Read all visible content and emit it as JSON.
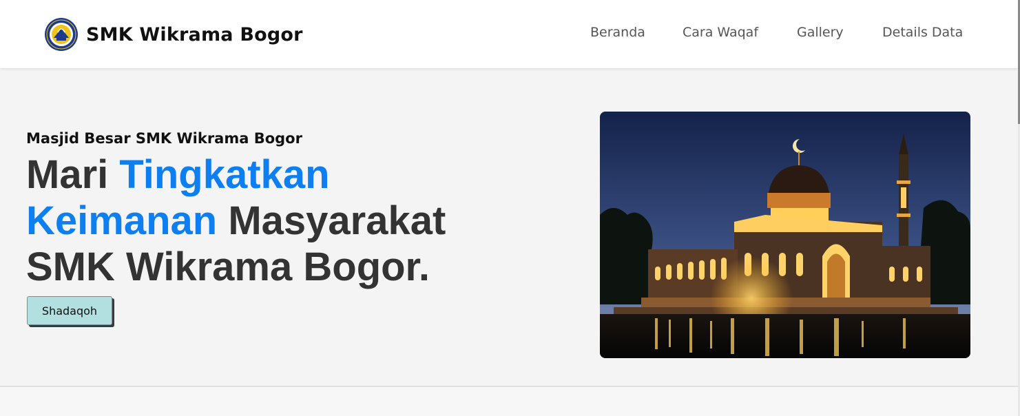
{
  "brand": {
    "name": "SMK Wikrama Bogor",
    "logo_icon": "school-crest-logo"
  },
  "nav": {
    "items": [
      {
        "label": "Beranda"
      },
      {
        "label": "Cara Waqaf"
      },
      {
        "label": "Gallery"
      },
      {
        "label": "Details Data"
      }
    ]
  },
  "hero": {
    "subtitle": "Masjid Besar SMK Wikrama Bogor",
    "title_part1": "Mari ",
    "title_accent1": "Tingkatkan",
    "title_accent2": "Keimanan",
    "title_part2": " Masyarakat SMK Wikrama Bogor.",
    "button_label": "Shadaqoh",
    "image_icon": "mosque-night-illustration"
  },
  "colors": {
    "accent": "#0d7ff0",
    "button_bg": "#b2e0e0",
    "navbar_bg": "#ffffff",
    "page_bg": "#f4f4f4"
  }
}
